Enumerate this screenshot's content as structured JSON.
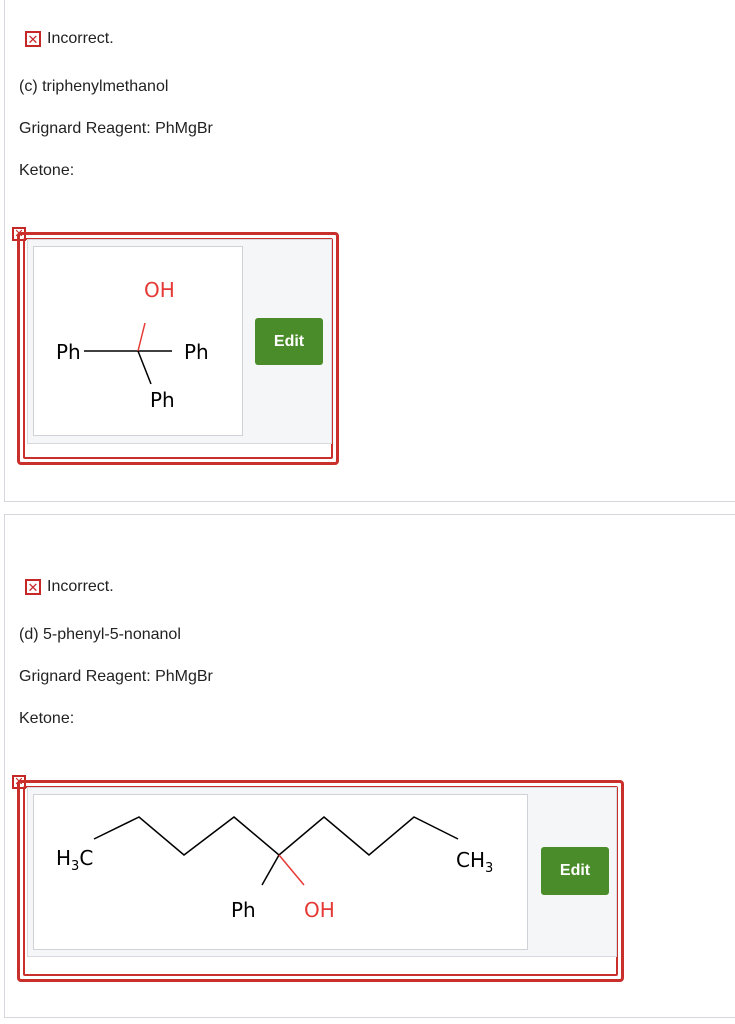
{
  "part_c": {
    "feedback": "Incorrect.",
    "question": "(c) triphenylmethanol",
    "grignard": "Grignard Reagent: PhMgBr",
    "ketone_label": "Ketone:",
    "structure": {
      "labels": {
        "oh": "OH",
        "left": "Ph",
        "right": "Ph",
        "bottom": "Ph"
      }
    },
    "edit_label": "Edit"
  },
  "part_d": {
    "feedback": "Incorrect.",
    "question": "(d) 5-phenyl-5-nonanol",
    "grignard": "Grignard Reagent: PhMgBr",
    "ketone_label": "Ketone:",
    "structure": {
      "labels": {
        "left_methyl": "H3C",
        "right_methyl": "CH3",
        "phenyl": "Ph",
        "oh": "OH"
      }
    },
    "edit_label": "Edit"
  },
  "colors": {
    "error": "#c9302c",
    "oxygen": "#e53935",
    "button": "#4a8c2a"
  },
  "icons": {
    "incorrect": "x-box-icon"
  }
}
